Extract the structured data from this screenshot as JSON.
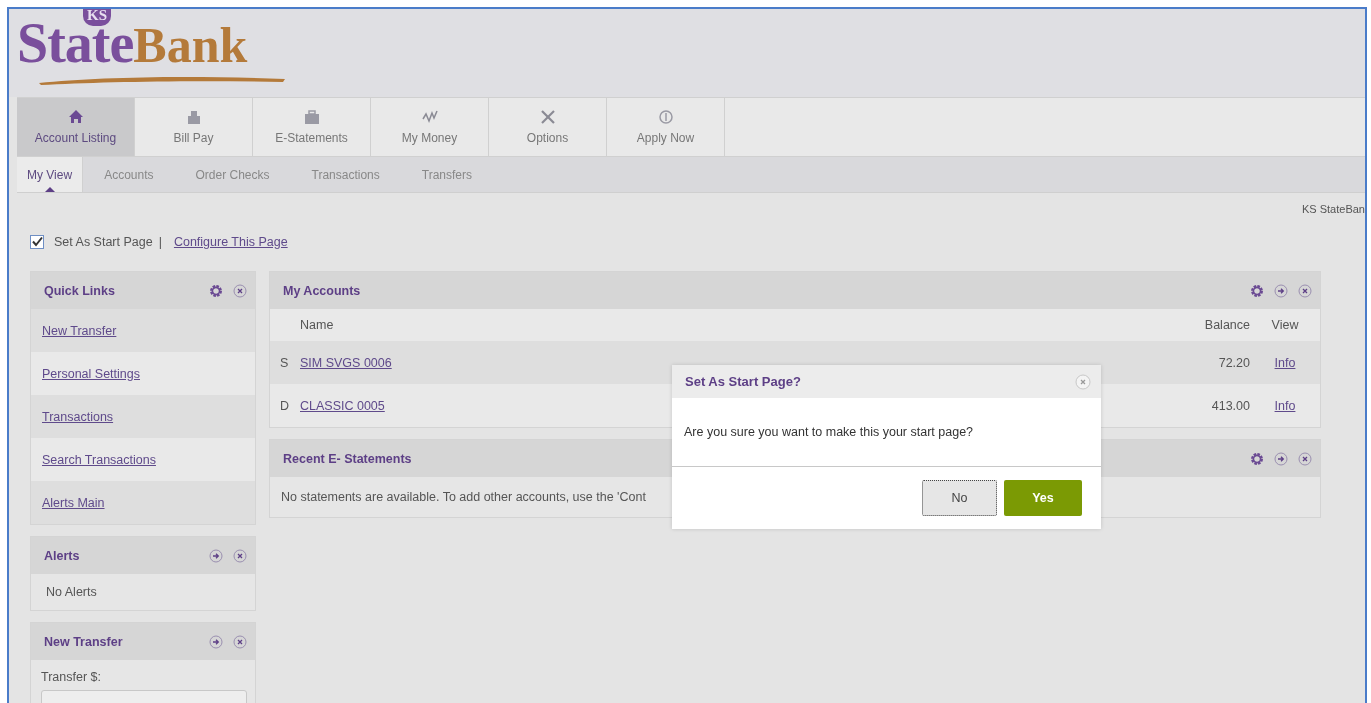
{
  "logo": {
    "badge": "KS",
    "part1": "State",
    "part2": "Bank"
  },
  "main_tabs": [
    {
      "label": "Account Listing",
      "selected": true
    },
    {
      "label": "Bill Pay",
      "selected": false
    },
    {
      "label": "E-Statements",
      "selected": false
    },
    {
      "label": "My Money",
      "selected": false
    },
    {
      "label": "Options",
      "selected": false
    },
    {
      "label": "Apply Now",
      "selected": false
    }
  ],
  "sub_tabs": [
    {
      "label": "My View",
      "selected": true
    },
    {
      "label": "Accounts",
      "selected": false
    },
    {
      "label": "Order Checks",
      "selected": false
    },
    {
      "label": "Transactions",
      "selected": false
    },
    {
      "label": "Transfers",
      "selected": false
    }
  ],
  "brand_note": "KS StateBan",
  "start_page": {
    "label": "Set As Start Page",
    "checked": true,
    "separator": "|",
    "link": "Configure This Page"
  },
  "quick_links": {
    "title": "Quick Links",
    "settings": true,
    "expand": false,
    "items": [
      "New Transfer",
      "Personal Settings",
      "Transactions",
      "Search Transactions",
      "Alerts Main"
    ]
  },
  "alerts": {
    "title": "Alerts",
    "settings": false,
    "expand": true,
    "message": "No Alerts"
  },
  "new_transfer": {
    "title": "New Transfer",
    "settings": false,
    "expand": true,
    "label": "Transfer $:"
  },
  "my_accounts": {
    "title": "My Accounts",
    "settings": true,
    "expand": true,
    "columns": [
      "Name",
      "Balance",
      "View"
    ],
    "rows": [
      {
        "type": "S",
        "name": "SIM SVGS 0006",
        "balance": "72.20",
        "view": "Info"
      },
      {
        "type": "D",
        "name": "CLASSIC 0005",
        "balance": "413.00",
        "view": "Info"
      }
    ]
  },
  "statements": {
    "title": "Recent E- Statements",
    "settings": true,
    "expand": true,
    "message": "No statements are available. To add other accounts, use the 'Cont"
  },
  "dialog": {
    "title": "Set As Start Page?",
    "message": "Are you sure you want to make this your start page?",
    "buttons": [
      "No",
      "Yes"
    ]
  }
}
